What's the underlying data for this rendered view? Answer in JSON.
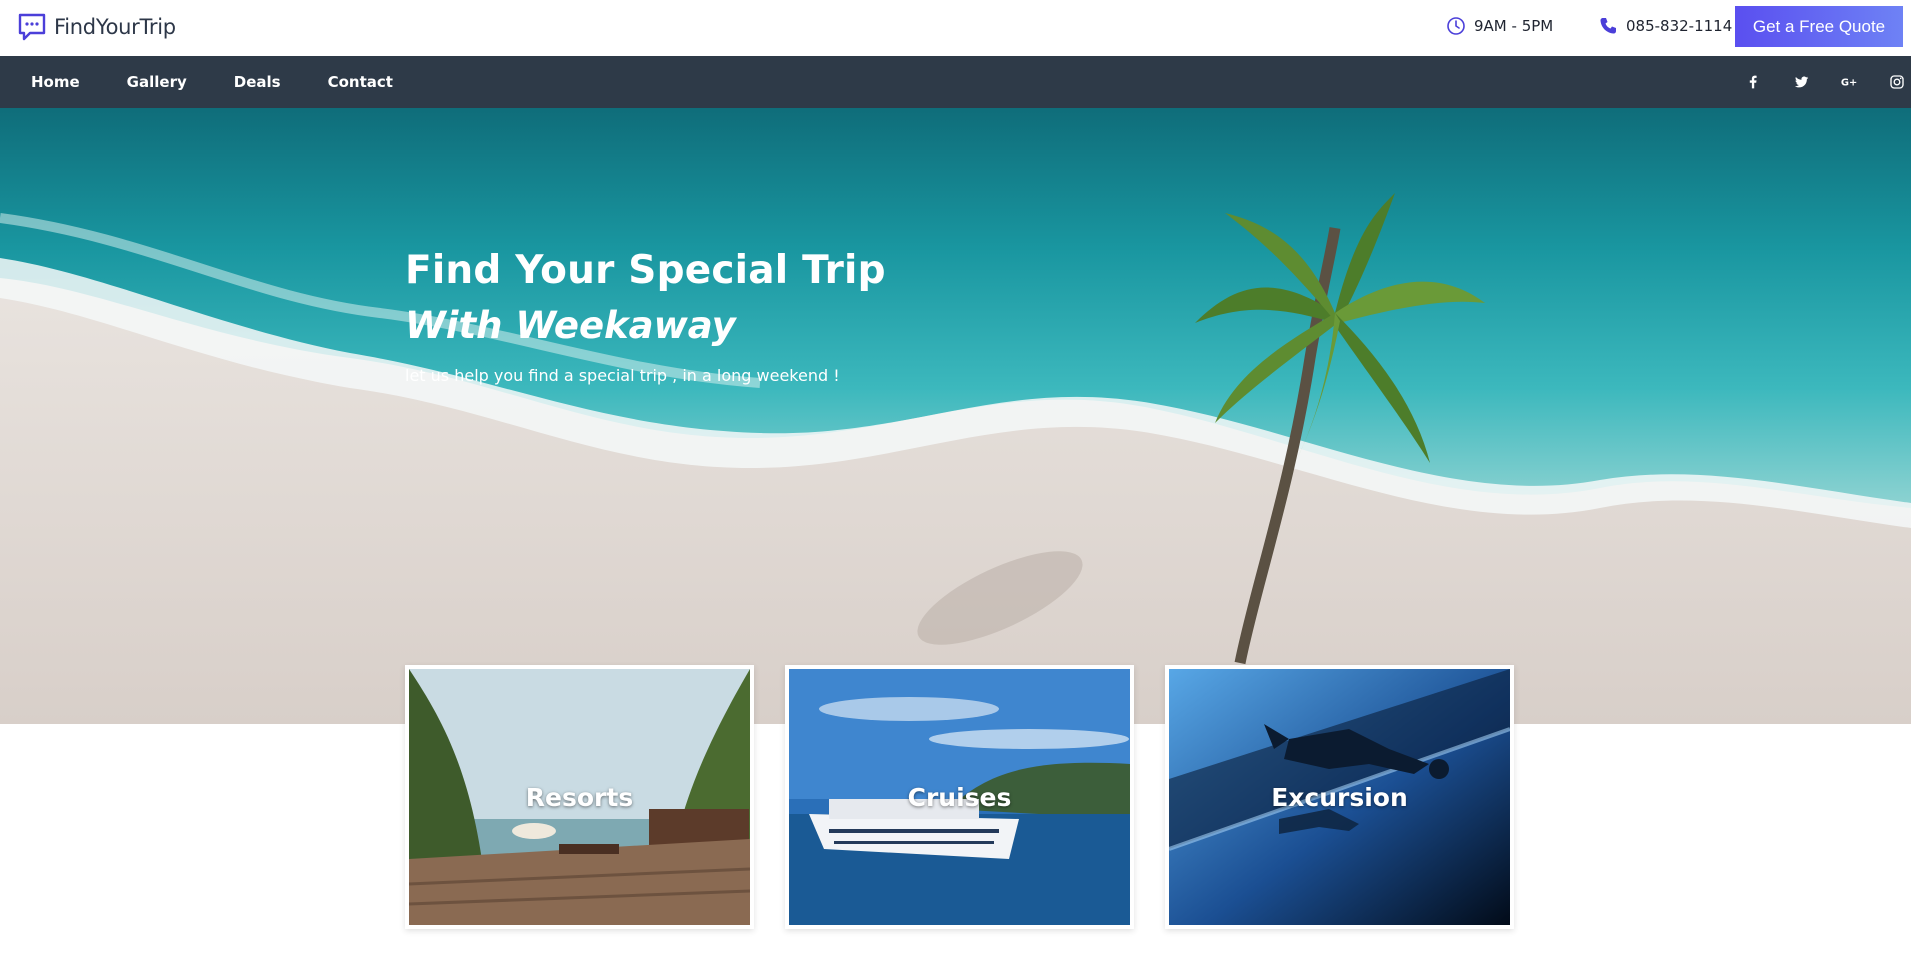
{
  "brand": {
    "name": "FindYourTrip"
  },
  "header": {
    "hours": "9AM - 5PM",
    "phone": "085-832-1114",
    "quote_button": "Get a Free Quote"
  },
  "nav": {
    "items": [
      {
        "label": "Home"
      },
      {
        "label": "Gallery"
      },
      {
        "label": "Deals"
      },
      {
        "label": "Contact"
      }
    ],
    "social": [
      "facebook-icon",
      "twitter-icon",
      "google-plus-icon",
      "instagram-icon"
    ]
  },
  "hero": {
    "title": "Find Your Special Trip",
    "subtitle": "With Weekaway",
    "tagline": "let us help you find a special trip , in a long weekend !"
  },
  "cards": [
    {
      "label": "Resorts"
    },
    {
      "label": "Cruises"
    },
    {
      "label": "Excursion"
    }
  ],
  "colors": {
    "accent": "#5a4ff0",
    "navbar": "#2e3a48"
  }
}
